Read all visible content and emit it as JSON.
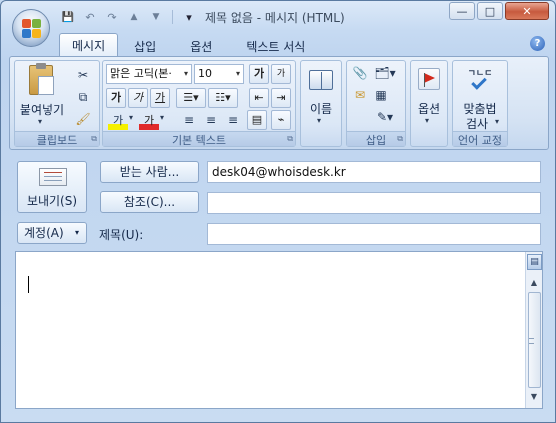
{
  "window": {
    "title": "제목 없음 - 메시지 (HTML)",
    "controls": [
      "—",
      "□",
      "✕"
    ]
  },
  "quick_access": {
    "icons": [
      "save-icon",
      "undo-icon",
      "redo-icon",
      "up-icon",
      "down-icon",
      "customize-icon"
    ],
    "glyphs": [
      "💾",
      "↶",
      "↷",
      "▲",
      "▼",
      "▾"
    ]
  },
  "tabs": [
    "메시지",
    "삽입",
    "옵션",
    "텍스트 서식"
  ],
  "help_glyph": "?",
  "ribbon": {
    "clipboard": {
      "paste_label": "붙여넣기",
      "group_label": "클립보드"
    },
    "basic_text": {
      "font_name": "맑은 고딕(본·",
      "font_size": "10",
      "grow_font": "가",
      "shrink_font": "가",
      "bold": "가",
      "italic": "가",
      "underline": "가",
      "highlight": "가",
      "font_color": "가",
      "group_label": "기본 텍스트"
    },
    "names": {
      "label": "이름"
    },
    "insert": {
      "group_label": "삽입"
    },
    "options": {
      "label": "옵션"
    },
    "proofing": {
      "icon_text": "ㄱㄴㄷ",
      "label_line1": "맞춤법",
      "label_line2": "검사",
      "group_label": "언어 교정"
    }
  },
  "form": {
    "send_label": "보내기(S)",
    "to_label": "받는 사람...",
    "cc_label": "참조(C)...",
    "account_label": "계정(A)",
    "subject_label": "제목(U):",
    "to_value": "desk04@whoisdesk.kr",
    "cc_value": "",
    "subject_value": ""
  }
}
